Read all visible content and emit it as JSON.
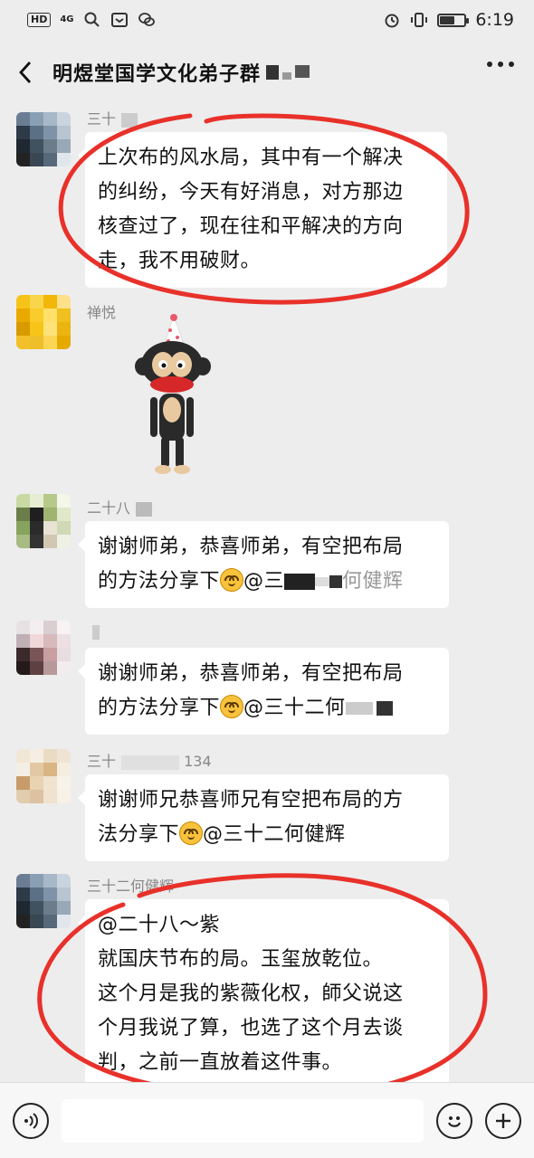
{
  "status_bar": {
    "hd_label": "HD",
    "network_label": "4G",
    "time": "6:19",
    "battery_level": 0.55
  },
  "nav": {
    "title": "明煜堂国学文化弟子群"
  },
  "messages": [
    {
      "sender": "三十",
      "lines": [
        "上次布的风水局，其中有一个解决",
        "的纠纷，今天有好消息，对方那边",
        "核查过了，现在往和平解决的方向",
        "走，我不用破财。"
      ]
    },
    {
      "sender": "禅悦",
      "sticker": "monkey-party-hat-sticker"
    },
    {
      "sender": "二十八",
      "lines": [
        "谢谢师弟，恭喜师弟，有空把布局",
        "的方法分享下"
      ],
      "tail": "@三",
      "tail_after": "何健辉"
    },
    {
      "sender": "",
      "lines": [
        "谢谢师弟，恭喜师弟，有空把布局",
        "的方法分享下"
      ],
      "tail": "@三十二何",
      "tail_after": ""
    },
    {
      "sender": "三十",
      "sender_suffix": "134",
      "lines": [
        "谢谢师兄恭喜师兄有空把布局的方",
        "法分享下"
      ],
      "tail": "@三十二何健辉",
      "tail_after": ""
    },
    {
      "sender": "三十二何健辉",
      "lines": [
        "@二十八～紫",
        "就国庆节布的局。玉玺放乾位。",
        "这个月是我的紫薇化权，師父说这",
        "个月我说了算，也选了这个月去谈",
        "判，之前一直放着这件事。"
      ]
    }
  ],
  "colors": {
    "background": "#ededed",
    "bubble": "#ffffff",
    "annotation_red": "#e8312a"
  },
  "icons": [
    "back-icon",
    "more-icon",
    "voice-icon",
    "emoji-icon",
    "add-icon"
  ]
}
